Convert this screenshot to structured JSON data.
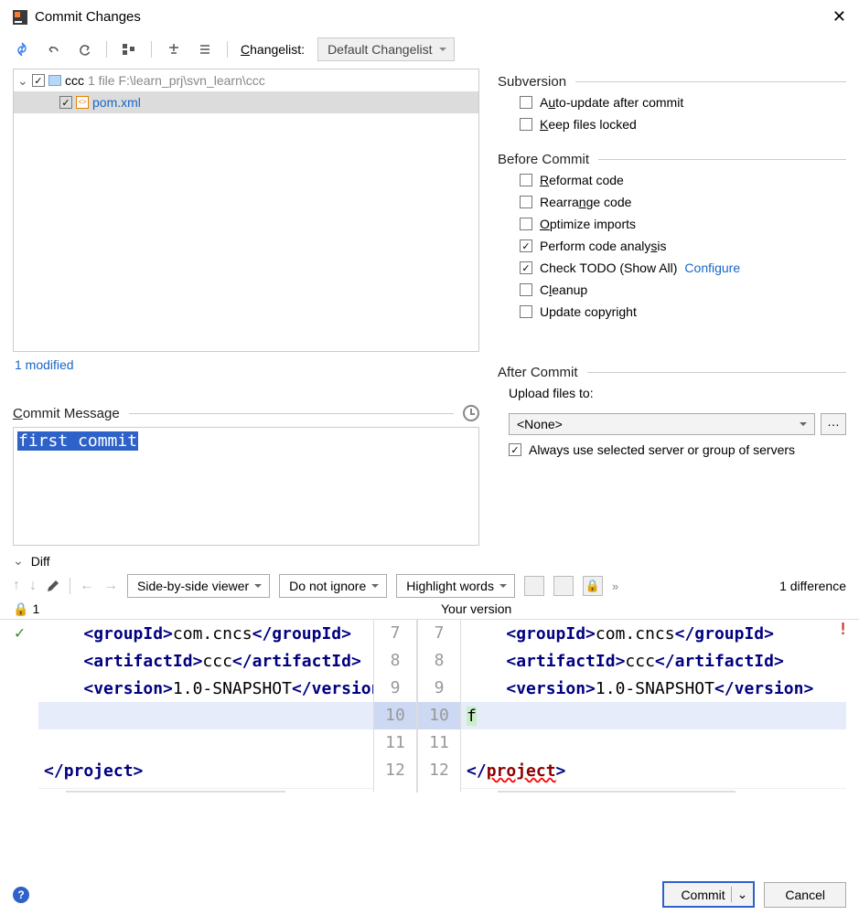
{
  "title": "Commit Changes",
  "changelist_label": "Changelist:",
  "changelist_value": "Default Changelist",
  "tree": {
    "root_name": "ccc",
    "root_meta": "1 file  F:\\learn_prj\\svn_learn\\ccc",
    "file": "pom.xml"
  },
  "modified_text": "1 modified",
  "commit_msg_label": "Commit Message",
  "commit_msg_value": "first commit",
  "subversion": {
    "title": "Subversion",
    "auto_update": "Auto-update after commit",
    "keep_locked": "Keep files locked"
  },
  "before": {
    "title": "Before Commit",
    "reformat": "Reformat code",
    "rearrange": "Rearrange code",
    "optimize": "Optimize imports",
    "analysis": "Perform code analysis",
    "todo": "Check TODO (Show All)",
    "configure": "Configure",
    "cleanup": "Cleanup",
    "copyright": "Update copyright"
  },
  "after": {
    "title": "After Commit",
    "upload_label": "Upload files to:",
    "upload_value": "<None>",
    "always": "Always use selected server or group of servers"
  },
  "diff": {
    "title": "Diff",
    "viewer": "Side-by-side viewer",
    "ignore": "Do not ignore",
    "highlight": "Highlight words",
    "count": "1 difference",
    "left_label": "1",
    "right_label": "Your version",
    "lines_left": [
      7,
      8,
      9,
      10,
      11,
      12
    ],
    "lines_right": [
      7,
      8,
      9,
      10,
      11,
      12
    ],
    "code": {
      "l7a": "<groupId>",
      "l7b": "com.cncs",
      "l7c": "</groupId>",
      "l8a": "<artifactId>",
      "l8b": "ccc",
      "l8c": "</artifactId>",
      "l9a": "<version>",
      "l9b": "1.0-SNAPSHOT",
      "l9c": "</version>",
      "l10r": "f",
      "l12a": "</",
      "l12b": "project",
      "l12c": ">"
    }
  },
  "footer": {
    "commit": "Commit",
    "cancel": "Cancel"
  }
}
